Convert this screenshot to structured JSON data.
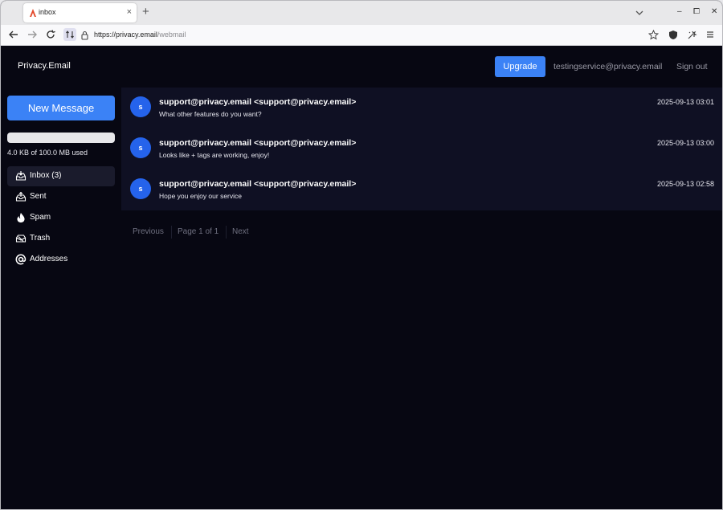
{
  "browser": {
    "tab_title": "inbox",
    "tab_close": "×",
    "new_tab": "+",
    "url_host": "https://privacy.email",
    "url_path": "/webmail",
    "window_controls": [
      "‒",
      "⧠",
      "✕"
    ]
  },
  "app": {
    "brand": "Privacy.Email",
    "upgrade_label": "Upgrade",
    "user_email": "testingservice@privacy.email",
    "signout_label": "Sign out",
    "accent_color": "#3b82f6"
  },
  "sidebar": {
    "compose_label": "New Message",
    "storage_text": "4.0 KB of 100.0 MB used",
    "storage_used_fraction": 4e-05,
    "folders": [
      {
        "label": "Inbox (3)",
        "icon": "inbox-icon",
        "active": true
      },
      {
        "label": "Sent",
        "icon": "sent-icon",
        "active": false
      },
      {
        "label": "Spam",
        "icon": "flame-icon",
        "active": false
      },
      {
        "label": "Trash",
        "icon": "trash-icon",
        "active": false
      },
      {
        "label": "Addresses",
        "icon": "at-icon",
        "active": false
      }
    ]
  },
  "messages": [
    {
      "avatar": "s",
      "from": "support@privacy.email <support@privacy.email>",
      "subject": "What other features do you want?",
      "date": "2025-09-13 03:01"
    },
    {
      "avatar": "s",
      "from": "support@privacy.email <support@privacy.email>",
      "subject": "Looks like + tags are working, enjoy!",
      "date": "2025-09-13 03:00"
    },
    {
      "avatar": "s",
      "from": "support@privacy.email <support@privacy.email>",
      "subject": "Hope you enjoy our service",
      "date": "2025-09-13 02:58"
    }
  ],
  "pagination": {
    "previous": "Previous",
    "page": "Page 1 of 1",
    "next": "Next"
  }
}
